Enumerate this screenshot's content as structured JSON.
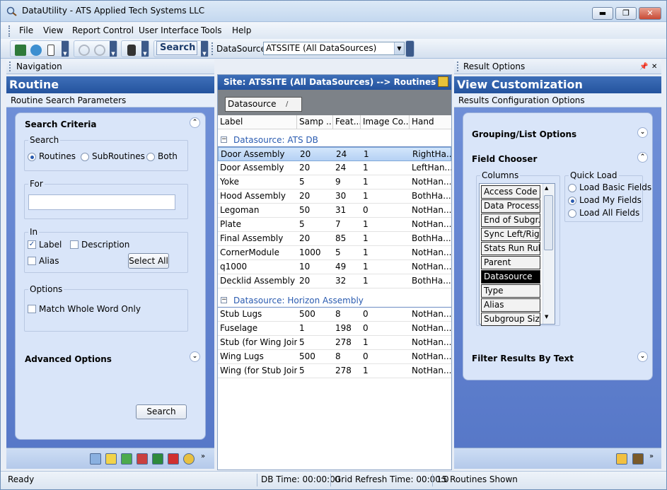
{
  "window": {
    "title": "DataUtility - ATS Applied Tech Systems LLC",
    "buttons": {
      "minimize": "▬",
      "maximize": "❐",
      "close": "✕"
    }
  },
  "menu": [
    "File",
    "View",
    "Report Control",
    "User Interface",
    "Tools",
    "Help"
  ],
  "toolbar": {
    "search_label": "Search",
    "datasource_label": "DataSource:",
    "datasource_value": "ATSSITE (All DataSources)"
  },
  "left": {
    "header": "Navigation",
    "band": "Routine",
    "sub": "Routine Search Parameters",
    "search_criteria": "Search Criteria",
    "search_group": "Search",
    "search_options": [
      "Routines",
      "SubRoutines",
      "Both"
    ],
    "search_selected": 0,
    "for_label": "For",
    "for_value": "",
    "in_group": "In",
    "in_label": "Label",
    "in_description": "Description",
    "in_alias": "Alias",
    "select_all": "Select All",
    "options_group": "Options",
    "match_whole": "Match Whole Word Only",
    "advanced": "Advanced Options",
    "search_button": "Search"
  },
  "center": {
    "title": "Site: ATSSITE (All DataSources) --> Routines",
    "group_chip": "Datasource",
    "group_chip_sort": "/",
    "columns": [
      "Label",
      "Samp ...",
      "Feat...",
      "Image Co...",
      "Hand"
    ],
    "groups": [
      {
        "name": "Datasource: ATS DB",
        "rows": [
          [
            "Door Assembly",
            "20",
            "24",
            "1",
            "RightHa..."
          ],
          [
            "Door Assembly",
            "20",
            "24",
            "1",
            "LeftHan..."
          ],
          [
            "Yoke",
            "5",
            "9",
            "1",
            "NotHan..."
          ],
          [
            "Hood Assembly",
            "20",
            "30",
            "1",
            "BothHa..."
          ],
          [
            "Legoman",
            "50",
            "31",
            "0",
            "NotHan..."
          ],
          [
            "Plate",
            "5",
            "7",
            "1",
            "NotHan..."
          ],
          [
            "Final Assembly",
            "20",
            "85",
            "1",
            "BothHa..."
          ],
          [
            "CornerModule",
            "1000",
            "5",
            "1",
            "NotHan..."
          ],
          [
            "q1000",
            "10",
            "49",
            "1",
            "NotHan..."
          ],
          [
            "Decklid Assembly",
            "20",
            "32",
            "1",
            "BothHa..."
          ]
        ]
      },
      {
        "name": "Datasource: Horizon Assembly",
        "rows": [
          [
            "Stub Lugs",
            "500",
            "8",
            "0",
            "NotHan..."
          ],
          [
            "Fuselage",
            "1",
            "198",
            "0",
            "NotHan..."
          ],
          [
            "Stub (for Wing Join)",
            "5",
            "278",
            "1",
            "NotHan..."
          ],
          [
            "Wing Lugs",
            "500",
            "8",
            "0",
            "NotHan..."
          ],
          [
            "Wing (for Stub Join)",
            "5",
            "278",
            "1",
            "NotHan..."
          ]
        ]
      }
    ]
  },
  "right": {
    "header": "Result Options",
    "band": "View Customization",
    "sub": "Results Configuration Options",
    "grouping": "Grouping/List Options",
    "field_chooser": "Field Chooser",
    "columns_label": "Columns",
    "columns": [
      "Access Code",
      "Data Processe...",
      "End of Subgr...",
      "Sync Left/Rig...",
      "Stats Run Rule",
      "Parent",
      "Datasource",
      "Type",
      "Alias",
      "Subgroup Size"
    ],
    "columns_selected": 6,
    "quick_load": "Quick Load",
    "quick_options": [
      "Load Basic Fields",
      "Load My Fields",
      "Load All Fields"
    ],
    "quick_selected": 1,
    "filter": "Filter Results By Text"
  },
  "status": {
    "ready": "Ready",
    "db_time": "DB Time: 00:00:00",
    "grid_refresh": "Grid Refresh Time: 00:00:0",
    "routines_shown": "15 Routines Shown"
  },
  "colors": {
    "accent_blue": "#2a5bb0",
    "panel_blue": "#5778c8",
    "selected_row": "#b5d1f4"
  }
}
